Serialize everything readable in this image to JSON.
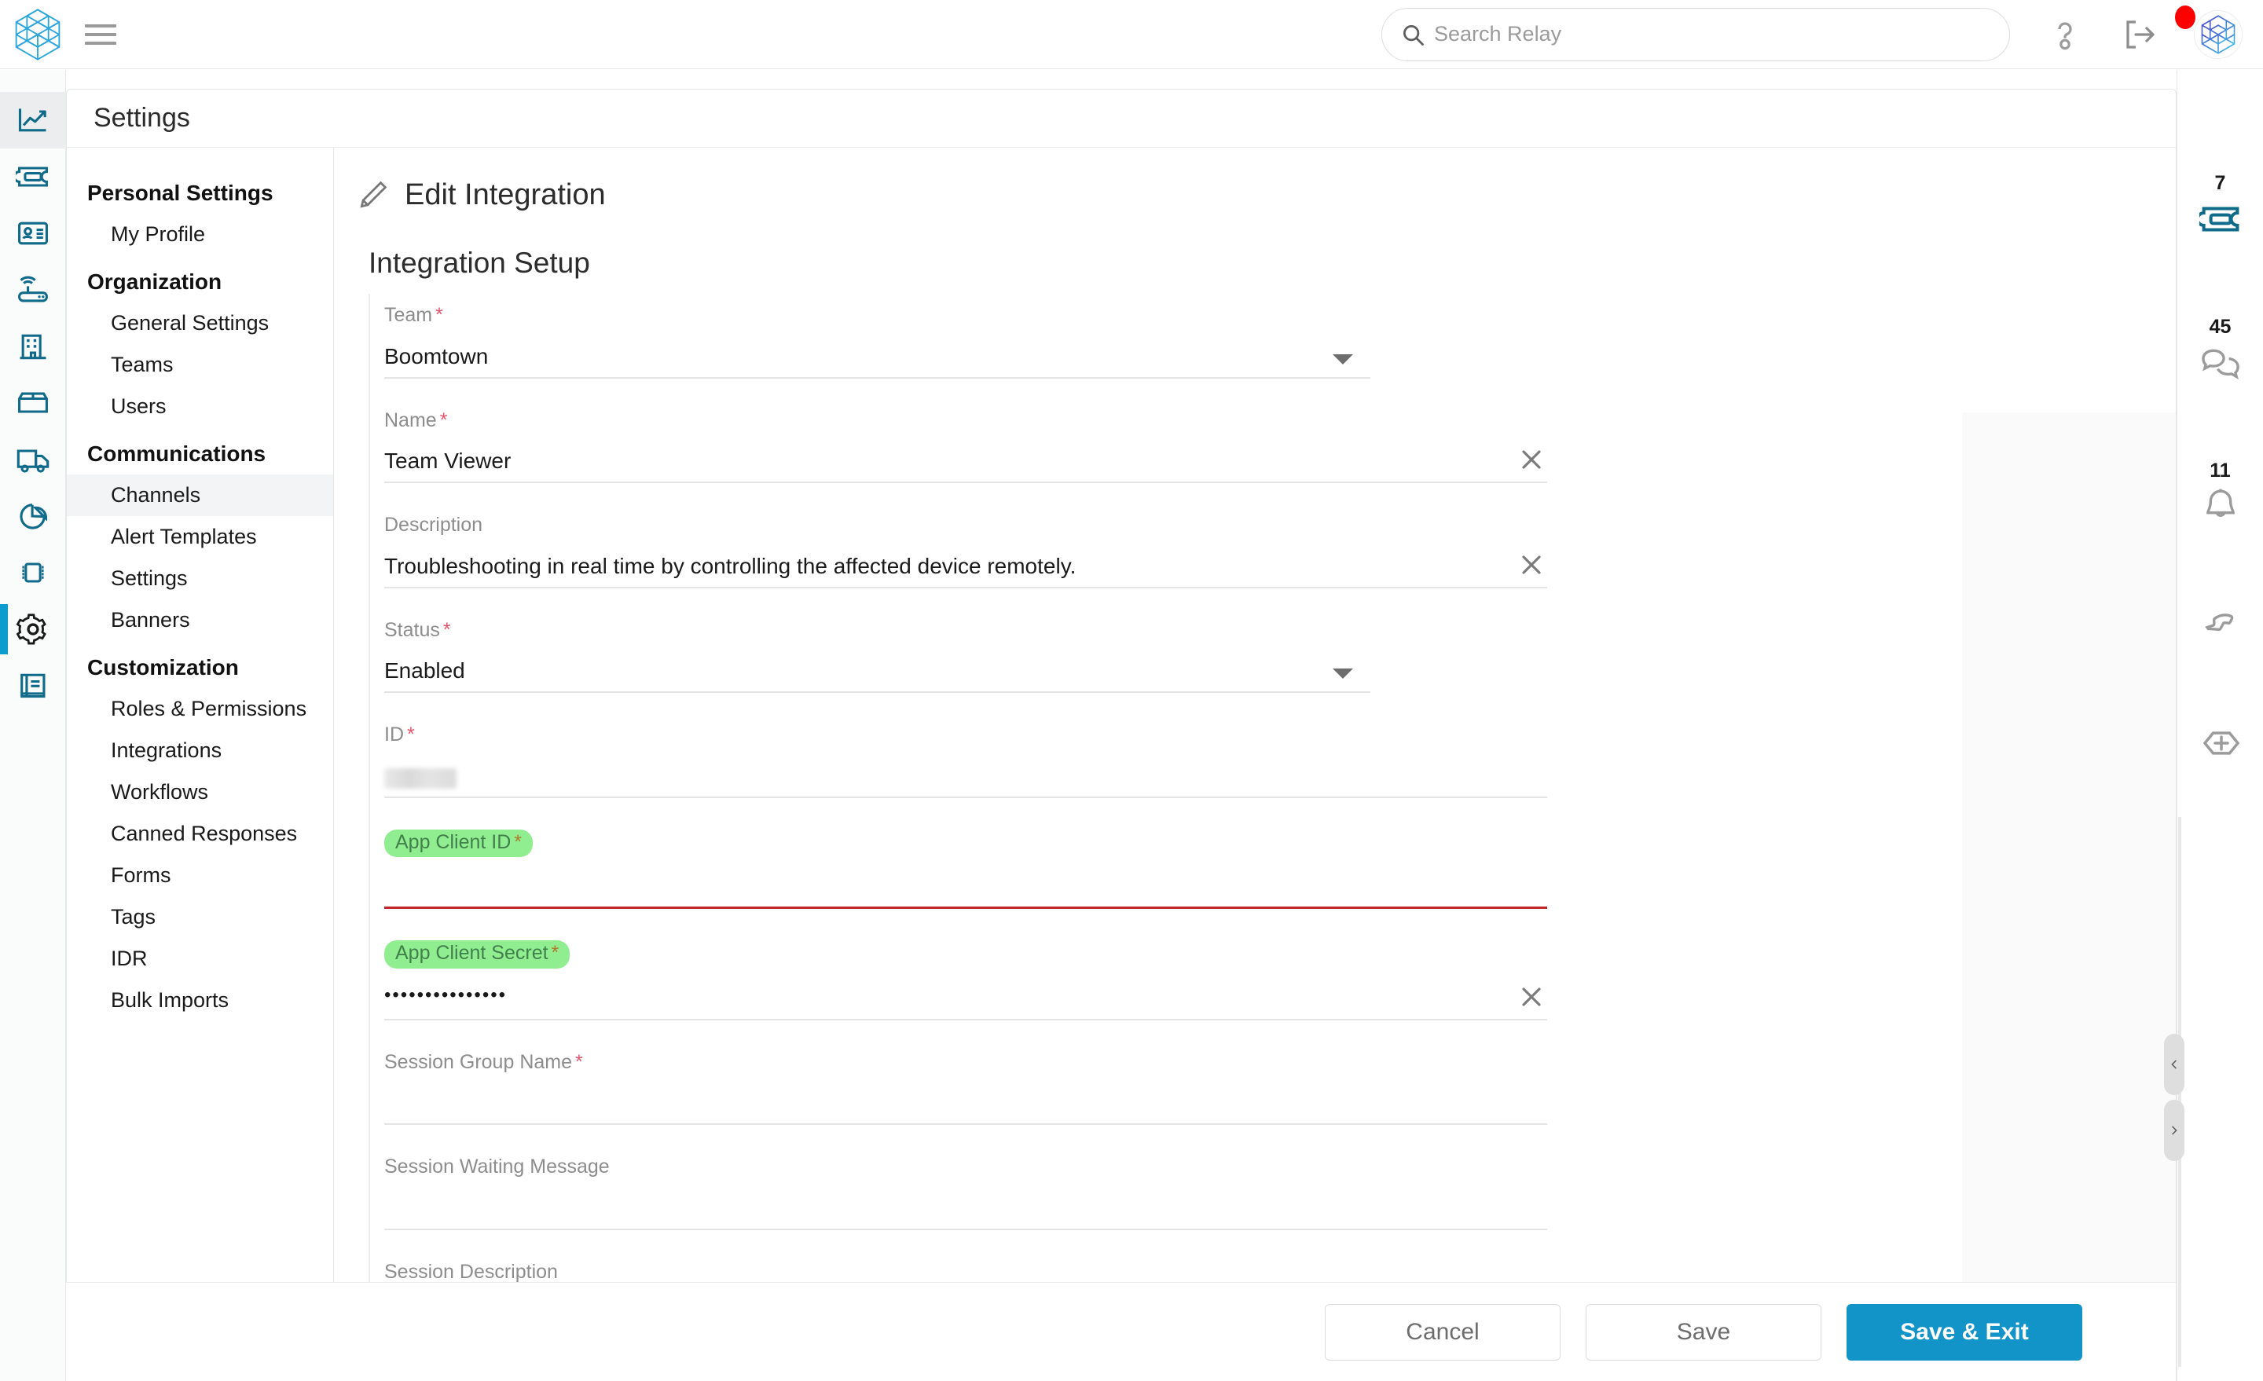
{
  "header": {
    "logo_icon": "hexagon-cube-logo",
    "menu_icon": "hamburger-menu-icon",
    "search": {
      "placeholder": "Search Relay",
      "value": "",
      "icon": "search-icon"
    },
    "help_icon": "question-mark-help-icon",
    "logout_icon": "logout-arrow-icon",
    "notification_dot": "red-notification-dot",
    "avatar_icon": "user-avatar-hexagon"
  },
  "left_rail": [
    {
      "name": "analytics",
      "icon": "line-chart-icon",
      "active": false
    },
    {
      "name": "tickets",
      "icon": "ticket-icon",
      "active": false
    },
    {
      "name": "contacts",
      "icon": "contact-card-icon",
      "active": false
    },
    {
      "name": "devices",
      "icon": "wifi-router-icon",
      "active": false
    },
    {
      "name": "organizations",
      "icon": "building-icon",
      "active": false
    },
    {
      "name": "inventory",
      "icon": "box-icon",
      "active": false
    },
    {
      "name": "shipping",
      "icon": "truck-icon",
      "active": false
    },
    {
      "name": "reports",
      "icon": "pie-chart-icon",
      "active": false
    },
    {
      "name": "hardware",
      "icon": "chip-icon",
      "active": false
    },
    {
      "name": "settings",
      "icon": "gear-icon",
      "active": true
    },
    {
      "name": "knowledge-base",
      "icon": "book-icon",
      "active": false
    }
  ],
  "settings": {
    "title": "Settings",
    "nav_groups": [
      {
        "title": "Personal Settings",
        "items": [
          {
            "label": "My Profile",
            "selected": false
          }
        ]
      },
      {
        "title": "Organization",
        "items": [
          {
            "label": "General Settings",
            "selected": false
          },
          {
            "label": "Teams",
            "selected": false
          },
          {
            "label": "Users",
            "selected": false
          }
        ]
      },
      {
        "title": "Communications",
        "items": [
          {
            "label": "Channels",
            "selected": true
          },
          {
            "label": "Alert Templates",
            "selected": false
          },
          {
            "label": "Settings",
            "selected": false
          },
          {
            "label": "Banners",
            "selected": false
          }
        ]
      },
      {
        "title": "Customization",
        "items": [
          {
            "label": "Roles & Permissions",
            "selected": false
          },
          {
            "label": "Integrations",
            "selected": false
          },
          {
            "label": "Workflows",
            "selected": false
          },
          {
            "label": "Canned Responses",
            "selected": false
          },
          {
            "label": "Forms",
            "selected": false
          },
          {
            "label": "Tags",
            "selected": false
          },
          {
            "label": "IDR",
            "selected": false
          },
          {
            "label": "Bulk Imports",
            "selected": false
          }
        ]
      }
    ]
  },
  "form": {
    "edit_title": "Edit Integration",
    "edit_icon": "pencil-edit-icon",
    "section_title": "Integration Setup",
    "fields": [
      {
        "label": "Team",
        "required": true,
        "value": "Boomtown",
        "control": "dropdown",
        "highlight": false,
        "error": false
      },
      {
        "label": "Name",
        "required": true,
        "value": "Team Viewer",
        "control": "text-clearable",
        "highlight": false,
        "error": false
      },
      {
        "label": "Description",
        "required": false,
        "value": "Troubleshooting in real time by controlling the affected device remotely.",
        "control": "text-clearable",
        "highlight": false,
        "error": false
      },
      {
        "label": "Status",
        "required": true,
        "value": "Enabled",
        "control": "dropdown",
        "highlight": false,
        "error": false
      },
      {
        "label": "ID",
        "required": true,
        "value": "",
        "control": "masked-blur",
        "highlight": false,
        "error": false
      },
      {
        "label": "App Client ID",
        "required": true,
        "value": "",
        "control": "text",
        "highlight": true,
        "error": true
      },
      {
        "label": "App Client Secret",
        "required": true,
        "value": "•••••••••••••••",
        "control": "password-clearable",
        "highlight": true,
        "error": false
      },
      {
        "label": "Session Group Name",
        "required": true,
        "value": "",
        "control": "text",
        "highlight": false,
        "error": false
      },
      {
        "label": "Session Waiting Message",
        "required": false,
        "value": "",
        "control": "text",
        "highlight": false,
        "error": false
      },
      {
        "label": "Session Description",
        "required": false,
        "value": "",
        "control": "text",
        "highlight": false,
        "error": false
      }
    ]
  },
  "footer": {
    "cancel_label": "Cancel",
    "save_label": "Save",
    "save_exit_label": "Save & Exit"
  },
  "right_rail": [
    {
      "name": "tickets",
      "icon": "ticket-icon",
      "count": "7",
      "accent": true
    },
    {
      "name": "messages",
      "icon": "chat-bubbles-icon",
      "count": "45",
      "accent": false
    },
    {
      "name": "notifications",
      "icon": "bell-icon",
      "count": "11",
      "accent": false
    },
    {
      "name": "calls",
      "icon": "phone-icon",
      "count": "",
      "accent": false
    },
    {
      "name": "add-new",
      "icon": "hexagon-plus-icon",
      "count": "",
      "accent": false
    }
  ],
  "panel_handles": {
    "collapse_icon": "chevron-left-icon",
    "expand_icon": "chevron-right-icon"
  },
  "colors": {
    "accent_blue": "#1294c9",
    "rail_active": "#0d9ccd",
    "icon_teal": "#106b8a",
    "highlight_green": "#90ee90",
    "error_red": "#c0282b",
    "required_red": "#e8546b",
    "notification_red": "#ff0000"
  }
}
